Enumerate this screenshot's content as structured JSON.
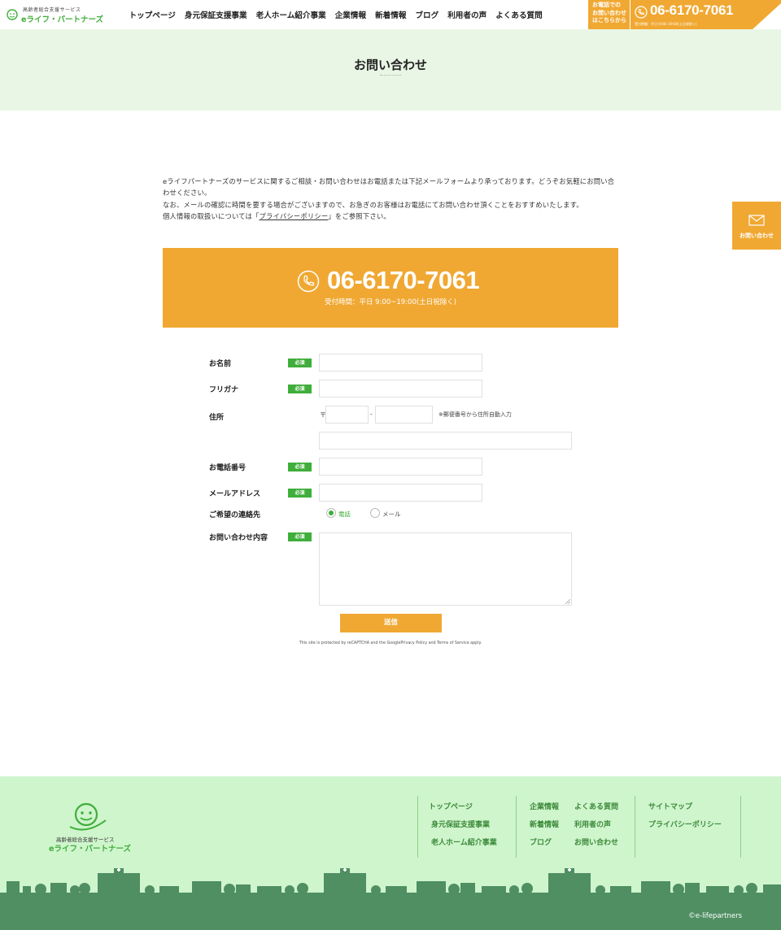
{
  "header": {
    "logo_tagline": "高齢者総合支援サービス",
    "logo_name": "eライフ・パートナーズ",
    "nav": [
      "トップページ",
      "身元保証支援事業",
      "老人ホーム紹介事業",
      "企業情報",
      "新着情報",
      "ブログ",
      "利用者の声",
      "よくある質問"
    ],
    "phone_note": [
      "お電話での",
      "お問い合わせ",
      "はこちらから"
    ],
    "phone_number": "06-6170-7061",
    "phone_hours": "受付時間：平日 9:00~19:00(土日祝除く)"
  },
  "hero": {
    "title": "お問い合わせ"
  },
  "intro": {
    "line1": "eライフパートナーズのサービスに関するご相談・お問い合わせはお電話または下記メールフォームより承っております。どうぞお気軽にお問い合わせください。",
    "line2": "なお、メールの確認に時間を要する場合がございますので、お急ぎのお客様はお電話にてお問い合わせ頂くことをおすすめいたします。",
    "line3_pre": "個人情報の取扱いについては「",
    "line3_link": "プライバシーポリシー",
    "line3_post": "」をご参照下さい。"
  },
  "side_tab": {
    "label": "お問い合わせ"
  },
  "banner": {
    "phone": "06-6170-7061",
    "hours": "受付時間：平日 9:00~19:00(土日祝除く)"
  },
  "form": {
    "required": "必須",
    "name_label": "お名前",
    "kana_label": "フリガナ",
    "address_label": "住所",
    "zip_mark": "〒",
    "zip_dash": "-",
    "zip_note": "※郵便番号から住所自動入力",
    "phone_label": "お電話番号",
    "email_label": "メールアドレス",
    "contact_label": "ご希望の連絡先",
    "contact_options": [
      "電話",
      "メール"
    ],
    "contact_selected": "電話",
    "message_label": "お問い合わせ内容",
    "submit_label": "送信",
    "recaptcha": "This site is protected by reCAPTCHA and the GooglePrivacy Policy and Terms of Service apply."
  },
  "footer": {
    "logo_tagline": "高齢者総合支援サービス",
    "logo_name": "eライフ・パートナーズ",
    "links": [
      "トップページ",
      "身元保証支援事業",
      "老人ホーム紹介事業",
      "企業情報",
      "新着情報",
      "ブログ",
      "よくある質問",
      "利用者の声",
      "お問い合わせ",
      "サイトマップ",
      "プライバシーポリシー"
    ],
    "copyright": "©e-lifepartners"
  },
  "colors": {
    "orange": "#f0a832",
    "green": "#3fae3a",
    "mint": "#e9f6e5",
    "footer_bg": "#cff5cd",
    "footer_bar": "#4f8f62"
  }
}
